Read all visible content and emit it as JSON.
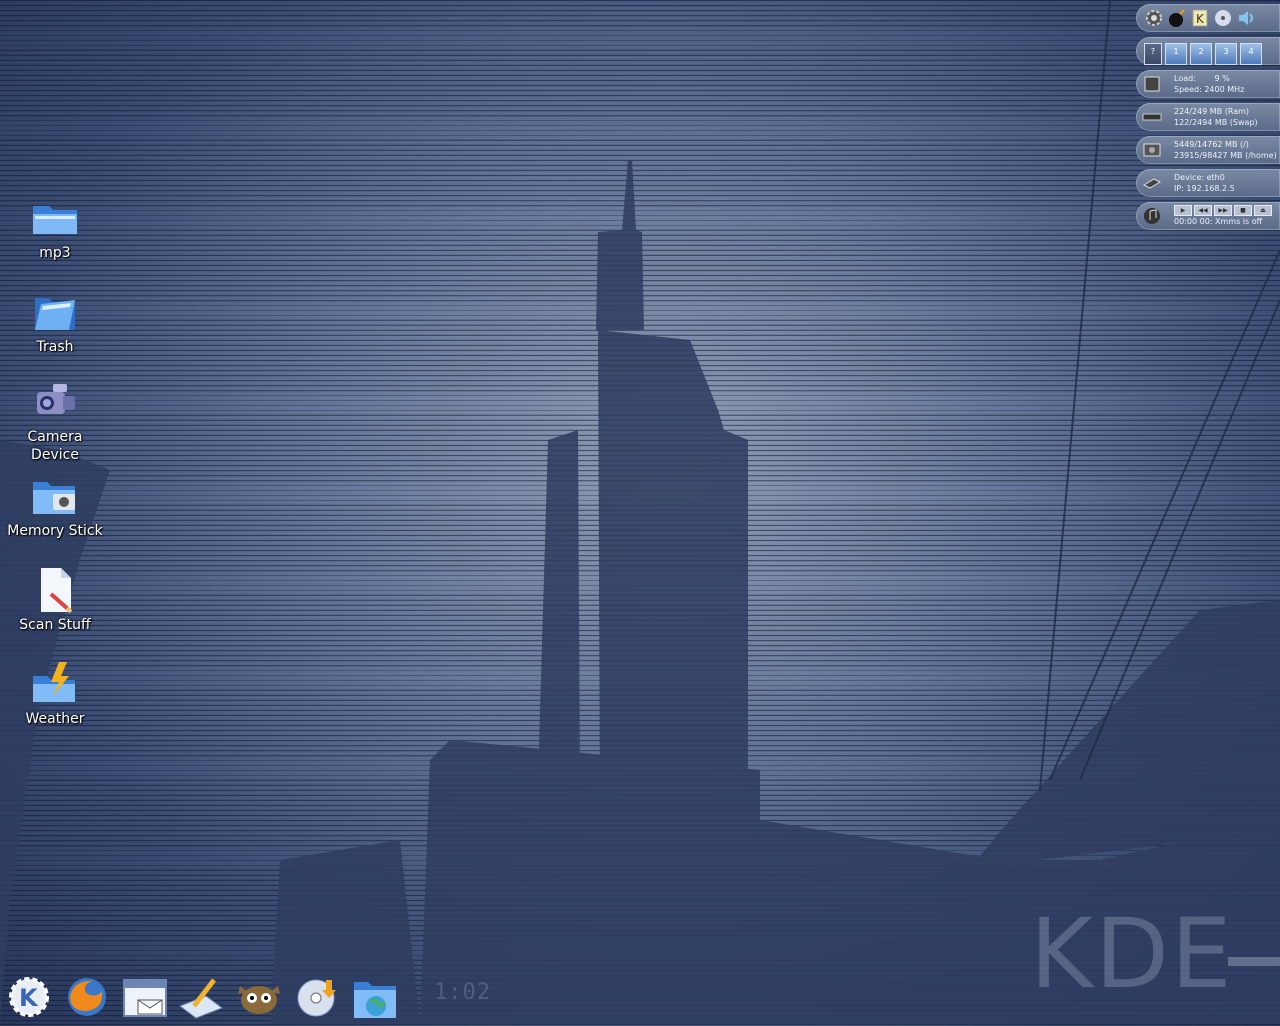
{
  "desktop": {
    "icons": [
      {
        "label": "mp3",
        "icon": "folder-icon"
      },
      {
        "label": "Trash",
        "icon": "trash-folder-icon"
      },
      {
        "label": "Camera Device",
        "icon": "camera-icon"
      },
      {
        "label": "Memory Stick",
        "icon": "memory-stick-icon"
      },
      {
        "label": "Scan Stuff",
        "icon": "document-icon"
      },
      {
        "label": "Weather",
        "icon": "weather-icon"
      }
    ],
    "watermark": "KDE"
  },
  "monitor": {
    "pager": [
      "1",
      "2",
      "3",
      "4"
    ],
    "cpu": {
      "load_label": "Load:",
      "load": "9 %",
      "speed_label": "Speed:",
      "speed": "2400 MHz"
    },
    "memory": {
      "ram": "224/249 MB (Ram)",
      "swap": "122/2494 MB (Swap)"
    },
    "disk": {
      "root": "5449/14762 MB (/)",
      "home": "23915/98427 MB (/home)"
    },
    "network": {
      "device": "Device: eth0",
      "ip": "IP: 192.168.2.5"
    },
    "xmms": {
      "status": "00:00 00: Xmms is off"
    }
  },
  "taskbar": {
    "items": [
      {
        "name": "kde-menu-icon"
      },
      {
        "name": "firefox-icon"
      },
      {
        "name": "mail-calendar-icon"
      },
      {
        "name": "editor-icon"
      },
      {
        "name": "gimp-icon"
      },
      {
        "name": "cd-burner-icon"
      },
      {
        "name": "network-folder-icon"
      }
    ],
    "clock": "1:02"
  },
  "colors": {
    "accent": "#4f7ab8",
    "wallpaper_dark": "#27365a",
    "wallpaper_light": "#8e9db3"
  }
}
